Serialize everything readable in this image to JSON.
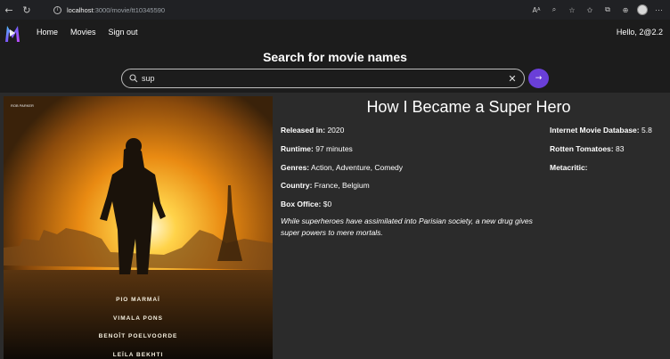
{
  "browser": {
    "url_host": "localhost",
    "url_path": ":3000/movie/tt10345590"
  },
  "header": {
    "nav": [
      "Home",
      "Movies",
      "Sign out"
    ],
    "greeting": "Hello, 2@2.2",
    "search_title": "Search for movie names",
    "search_value": "sup",
    "accent": "#6a3fd8"
  },
  "movie": {
    "title": "How I Became a Super Hero",
    "released_label": "Released in:",
    "released": "2020",
    "runtime_label": "Runtime:",
    "runtime": "97 minutes",
    "genres_label": "Genres:",
    "genres": "Action, Adventure, Comedy",
    "country_label": "Country:",
    "country": "France, Belgium",
    "box_office_label": "Box Office:",
    "box_office": "$0",
    "plot": "While superheroes have assimilated into Parisian society, a new drug gives super powers to mere mortals."
  },
  "ratings": {
    "imdb_label": "Internet Movie Database:",
    "imdb": "5.8",
    "rt_label": "Rotten Tomatoes:",
    "rt": "83",
    "mc_label": "Metacritic:",
    "mc": ""
  },
  "poster": {
    "credits": [
      "PIO MARMAÏ",
      "VIMALA PONS",
      "BENOÎT POELVOORDE",
      "LEÏLA BEKHTI"
    ],
    "tagline": "ROB PARKER"
  }
}
